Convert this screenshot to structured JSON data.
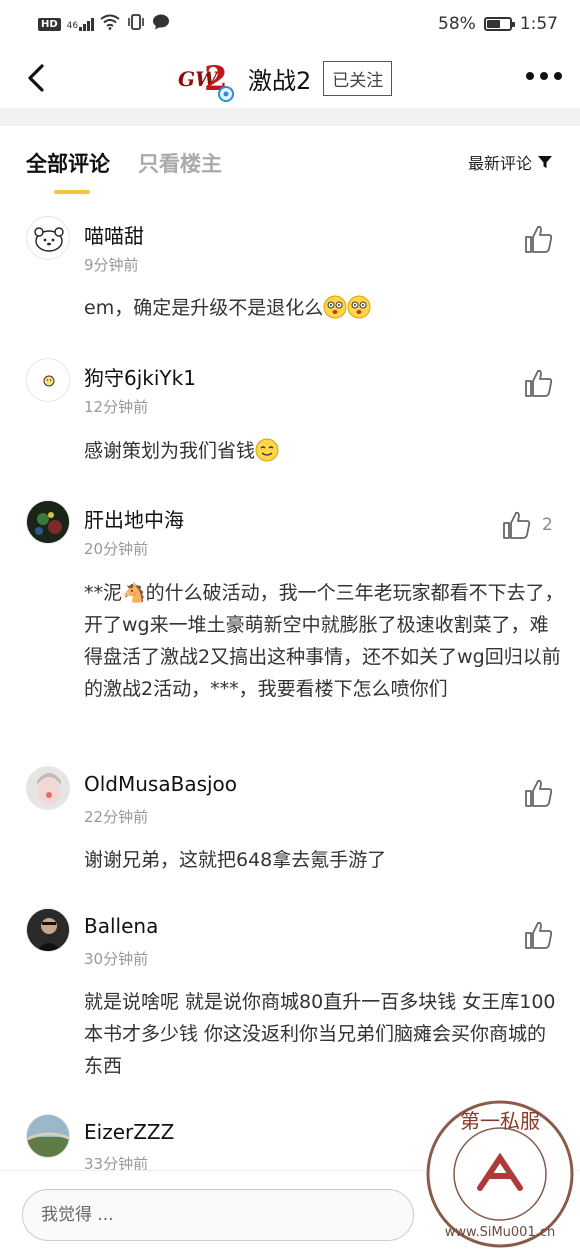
{
  "status": {
    "network": "46",
    "battery": "58%",
    "battery_level": 0.58,
    "time": "1:57"
  },
  "header": {
    "title": "激战2",
    "follow_label": "已关注"
  },
  "tabs": [
    {
      "label": "全部评论",
      "active": true
    },
    {
      "label": "只看楼主",
      "active": false
    }
  ],
  "sort": {
    "label": "最新评论"
  },
  "comments": [
    {
      "user": "喵喵甜",
      "time": "9分钟前",
      "text": "em，确定是升级不是退化么",
      "likes": ""
    },
    {
      "user": "狗守6jkiYk1",
      "time": "12分钟前",
      "text": "感谢策划为我们省钱",
      "likes": ""
    },
    {
      "user": "肝出地中海",
      "time": "20分钟前",
      "text": "**泥🐴的什么破活动，我一个三年老玩家都看不下去了，开了wg来一堆土豪萌新空中就膨胀了极速收割菜了，难得盘活了激战2又搞出这种事情，还不如关了wg回归以前的激战2活动，***，我要看楼下怎么喷你们",
      "likes": "2"
    },
    {
      "user": "OldMusaBasjoo",
      "time": "22分钟前",
      "text": "谢谢兄弟，这就把648拿去氪手游了",
      "likes": ""
    },
    {
      "user": "Ballena",
      "time": "30分钟前",
      "text": "就是说啥呢 就是说你商城80直升一百多块钱 女王库100本书才多少钱 你这没返利你当兄弟们脑瘫会买你商城的东西",
      "likes": ""
    },
    {
      "user": "EizerZZZ",
      "time": "33分钟前",
      "text": "",
      "likes": ""
    }
  ],
  "composer": {
    "placeholder": "我觉得 ..."
  },
  "watermark": {
    "title": "第一私服",
    "url": "www.SiMu001.cn"
  },
  "colors": {
    "accent": "#f5c542",
    "muted": "#999999",
    "text": "#333333"
  },
  "icons": [
    "back-arrow-icon",
    "more-icon",
    "thumbs-up-icon",
    "filter-icon",
    "wifi-icon",
    "battery-icon"
  ]
}
